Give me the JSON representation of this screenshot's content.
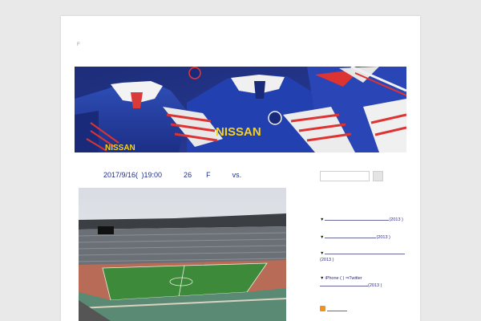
{
  "site": {
    "title": "F"
  },
  "header_image": {
    "description_icon": "football-jerseys-banner",
    "jersey_sponsor": "NISSAN",
    "jersey_sponsor_2": "NISSAN"
  },
  "post": {
    "title": "2017/9/16( )19:00      26    F      vs."
  },
  "search": {
    "placeholder": "",
    "button_icon": "search-button"
  },
  "sidebar": {
    "items": [
      {
        "arrow": "▼",
        "text": "",
        "year": "(2013 )"
      },
      {
        "arrow": "▼",
        "text": "",
        "year": "(2013 )"
      },
      {
        "arrow": "▼",
        "text": "",
        "year": "(2013 )"
      },
      {
        "arrow": "▼",
        "text": "iPhone          (        )        ⇒Twitter",
        "year": "(2013 )"
      }
    ],
    "rss_icon": "rss-icon"
  },
  "colors": {
    "background": "#e9e9e9",
    "page": "#ffffff",
    "link": "#1e2f8c",
    "rss": "#f2911b"
  }
}
